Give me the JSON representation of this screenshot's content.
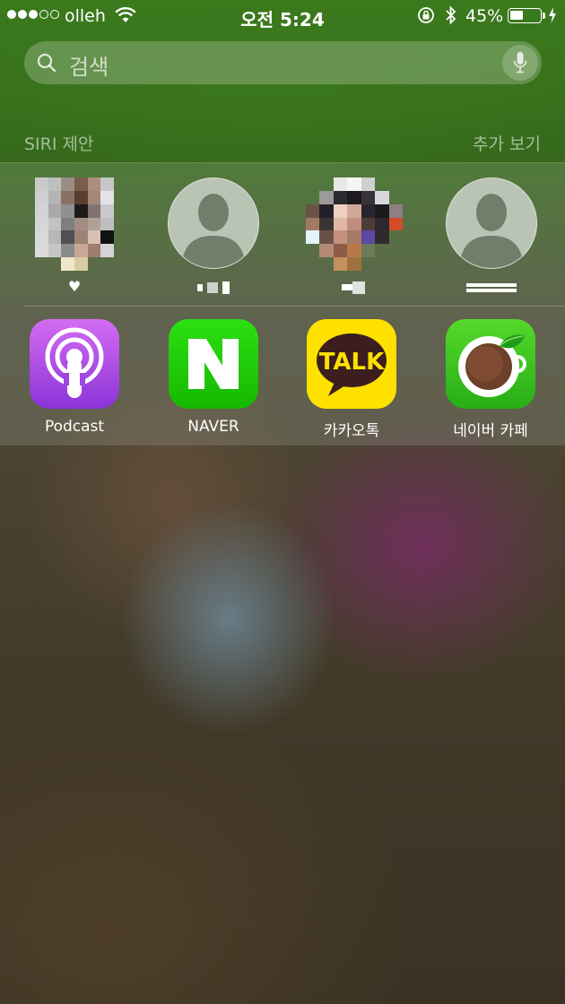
{
  "status_bar": {
    "carrier": "olleh",
    "time": "오전 5:24",
    "battery_percent": "45%",
    "battery_level": 0.45,
    "signal_bars_filled": 3,
    "signal_bars_total": 5
  },
  "search": {
    "placeholder": "검색",
    "icon": "search-icon",
    "mic_icon": "microphone-icon"
  },
  "siri": {
    "title": "SIRI 제안",
    "show_more": "추가 보기"
  },
  "contacts": [
    {
      "label": "♥",
      "avatar": "photo"
    },
    {
      "label": "",
      "avatar": "default-person-icon"
    },
    {
      "label": "",
      "avatar": "photo"
    },
    {
      "label": "",
      "avatar": "default-person-icon"
    }
  ],
  "apps": [
    {
      "label": "Podcast",
      "icon": "podcast-icon",
      "color": "#b64fe6"
    },
    {
      "label": "NAVER",
      "icon": "naver-icon",
      "color": "#1ec800"
    },
    {
      "label": "카카오톡",
      "icon": "kakaotalk-icon",
      "color": "#fae100"
    },
    {
      "label": "네이버 카페",
      "icon": "naver-cafe-icon",
      "color": "#38c61e"
    }
  ]
}
